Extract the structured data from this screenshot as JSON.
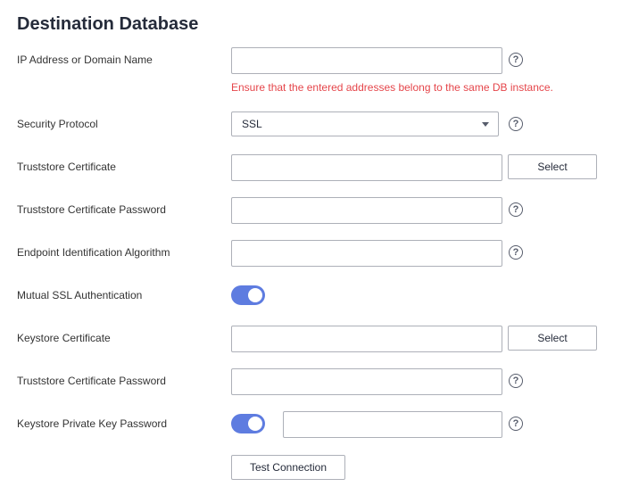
{
  "section": {
    "title": "Destination Database"
  },
  "fields": {
    "ip_address": {
      "label": "IP Address or Domain Name",
      "value": "",
      "hint": "Ensure that the entered addresses belong to the same DB instance."
    },
    "security_protocol": {
      "label": "Security Protocol",
      "value": "SSL"
    },
    "truststore_certificate": {
      "label": "Truststore Certificate",
      "value": "",
      "button": "Select"
    },
    "truststore_password": {
      "label": "Truststore Certificate Password",
      "value": ""
    },
    "endpoint_algorithm": {
      "label": "Endpoint Identification Algorithm",
      "value": ""
    },
    "mutual_ssl": {
      "label": "Mutual SSL Authentication",
      "enabled": true
    },
    "keystore_certificate": {
      "label": "Keystore Certificate",
      "value": "",
      "button": "Select"
    },
    "truststore_password_2": {
      "label": "Truststore Certificate Password",
      "value": ""
    },
    "keystore_private_key_password": {
      "label": "Keystore Private Key Password",
      "enabled": true,
      "value": ""
    }
  },
  "icons": {
    "help": "question-circle-icon",
    "help_glyph": "?"
  },
  "actions": {
    "test_connection": "Test Connection"
  },
  "colors": {
    "accent": "#5e7ce0",
    "error": "#e5454a",
    "border": "#adb0b8"
  }
}
